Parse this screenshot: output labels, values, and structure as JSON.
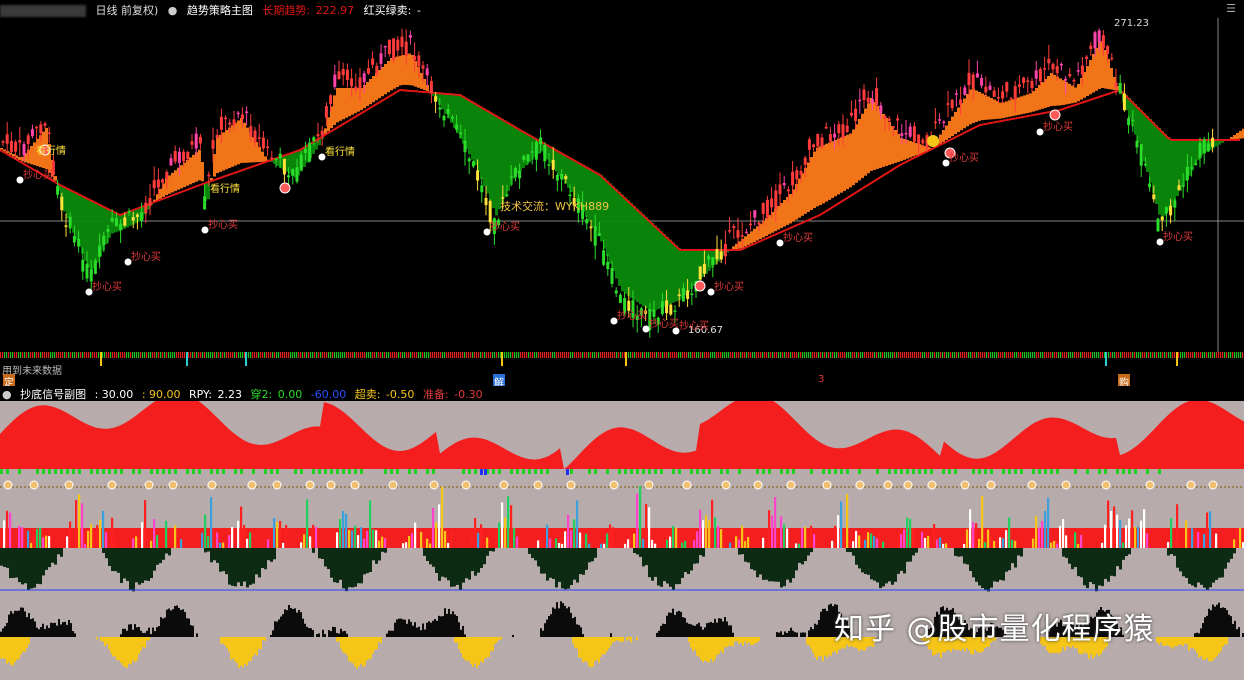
{
  "main": {
    "header": {
      "period_label": "日线 前复权)",
      "indicator_name": "趋势策略主图",
      "trend_label": "长期趋势:",
      "trend_value": "222.97",
      "signal_label": "红买绿卖:",
      "signal_value": "-"
    },
    "high_price_label": "271.23",
    "low_price_label": "160.67",
    "annotation_text": "技术交流：WYKH889",
    "signal_labels": {
      "buy": "抄心买",
      "trend": "看行情"
    },
    "future_data_notice": "用到未来数据",
    "marker_letters": [
      "定",
      "解",
      "3",
      "购"
    ],
    "colors": {
      "up_candle": "#ff3b3b",
      "down_candle": "#2bdc2b",
      "trend_line": "#e01616",
      "bull_band": "#ff7a1a",
      "bear_band": "#0a8a0a",
      "background": "#000000"
    }
  },
  "sub": {
    "header": {
      "title": "抄底信号副图",
      "p1": ": 30.00",
      "p2": ": 90.00",
      "rpy_label": "RPY:",
      "rpy_value": "2.23",
      "chuan_label": "穿2:",
      "chuan_value": "0.00",
      "blue_value": "-60.00",
      "chaomai_label": "超卖:",
      "chaomai_value": "-0.50",
      "zhunbei_label": "准备:",
      "zhunbei_value": "-0.30"
    },
    "colors": {
      "panel_bg": "#b7acab",
      "red_area": "#f41e1e",
      "yellow_area": "#f5c518",
      "black_area": "#0b0b0b"
    }
  },
  "watermark": "知乎 @股市量化程序猿"
}
